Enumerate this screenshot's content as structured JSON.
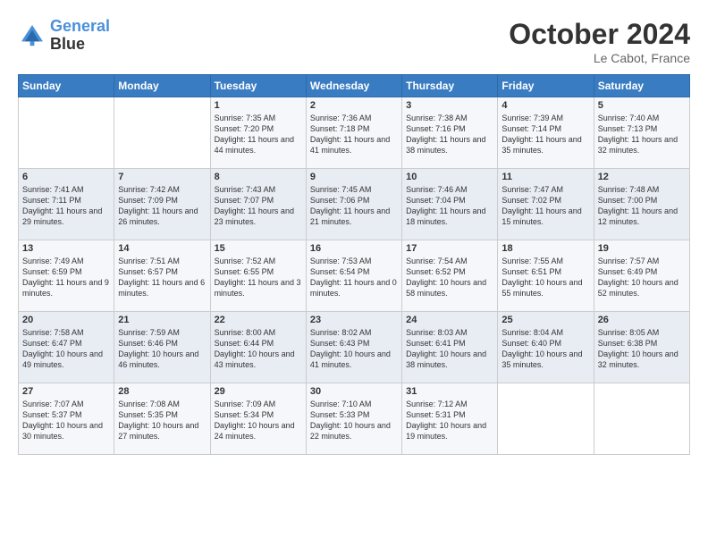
{
  "header": {
    "logo_line1": "General",
    "logo_line2": "Blue",
    "month": "October 2024",
    "location": "Le Cabot, France"
  },
  "weekdays": [
    "Sunday",
    "Monday",
    "Tuesday",
    "Wednesday",
    "Thursday",
    "Friday",
    "Saturday"
  ],
  "weeks": [
    [
      {
        "day": null
      },
      {
        "day": null
      },
      {
        "day": "1",
        "sunrise": "Sunrise: 7:35 AM",
        "sunset": "Sunset: 7:20 PM",
        "daylight": "Daylight: 11 hours and 44 minutes."
      },
      {
        "day": "2",
        "sunrise": "Sunrise: 7:36 AM",
        "sunset": "Sunset: 7:18 PM",
        "daylight": "Daylight: 11 hours and 41 minutes."
      },
      {
        "day": "3",
        "sunrise": "Sunrise: 7:38 AM",
        "sunset": "Sunset: 7:16 PM",
        "daylight": "Daylight: 11 hours and 38 minutes."
      },
      {
        "day": "4",
        "sunrise": "Sunrise: 7:39 AM",
        "sunset": "Sunset: 7:14 PM",
        "daylight": "Daylight: 11 hours and 35 minutes."
      },
      {
        "day": "5",
        "sunrise": "Sunrise: 7:40 AM",
        "sunset": "Sunset: 7:13 PM",
        "daylight": "Daylight: 11 hours and 32 minutes."
      }
    ],
    [
      {
        "day": "6",
        "sunrise": "Sunrise: 7:41 AM",
        "sunset": "Sunset: 7:11 PM",
        "daylight": "Daylight: 11 hours and 29 minutes."
      },
      {
        "day": "7",
        "sunrise": "Sunrise: 7:42 AM",
        "sunset": "Sunset: 7:09 PM",
        "daylight": "Daylight: 11 hours and 26 minutes."
      },
      {
        "day": "8",
        "sunrise": "Sunrise: 7:43 AM",
        "sunset": "Sunset: 7:07 PM",
        "daylight": "Daylight: 11 hours and 23 minutes."
      },
      {
        "day": "9",
        "sunrise": "Sunrise: 7:45 AM",
        "sunset": "Sunset: 7:06 PM",
        "daylight": "Daylight: 11 hours and 21 minutes."
      },
      {
        "day": "10",
        "sunrise": "Sunrise: 7:46 AM",
        "sunset": "Sunset: 7:04 PM",
        "daylight": "Daylight: 11 hours and 18 minutes."
      },
      {
        "day": "11",
        "sunrise": "Sunrise: 7:47 AM",
        "sunset": "Sunset: 7:02 PM",
        "daylight": "Daylight: 11 hours and 15 minutes."
      },
      {
        "day": "12",
        "sunrise": "Sunrise: 7:48 AM",
        "sunset": "Sunset: 7:00 PM",
        "daylight": "Daylight: 11 hours and 12 minutes."
      }
    ],
    [
      {
        "day": "13",
        "sunrise": "Sunrise: 7:49 AM",
        "sunset": "Sunset: 6:59 PM",
        "daylight": "Daylight: 11 hours and 9 minutes."
      },
      {
        "day": "14",
        "sunrise": "Sunrise: 7:51 AM",
        "sunset": "Sunset: 6:57 PM",
        "daylight": "Daylight: 11 hours and 6 minutes."
      },
      {
        "day": "15",
        "sunrise": "Sunrise: 7:52 AM",
        "sunset": "Sunset: 6:55 PM",
        "daylight": "Daylight: 11 hours and 3 minutes."
      },
      {
        "day": "16",
        "sunrise": "Sunrise: 7:53 AM",
        "sunset": "Sunset: 6:54 PM",
        "daylight": "Daylight: 11 hours and 0 minutes."
      },
      {
        "day": "17",
        "sunrise": "Sunrise: 7:54 AM",
        "sunset": "Sunset: 6:52 PM",
        "daylight": "Daylight: 10 hours and 58 minutes."
      },
      {
        "day": "18",
        "sunrise": "Sunrise: 7:55 AM",
        "sunset": "Sunset: 6:51 PM",
        "daylight": "Daylight: 10 hours and 55 minutes."
      },
      {
        "day": "19",
        "sunrise": "Sunrise: 7:57 AM",
        "sunset": "Sunset: 6:49 PM",
        "daylight": "Daylight: 10 hours and 52 minutes."
      }
    ],
    [
      {
        "day": "20",
        "sunrise": "Sunrise: 7:58 AM",
        "sunset": "Sunset: 6:47 PM",
        "daylight": "Daylight: 10 hours and 49 minutes."
      },
      {
        "day": "21",
        "sunrise": "Sunrise: 7:59 AM",
        "sunset": "Sunset: 6:46 PM",
        "daylight": "Daylight: 10 hours and 46 minutes."
      },
      {
        "day": "22",
        "sunrise": "Sunrise: 8:00 AM",
        "sunset": "Sunset: 6:44 PM",
        "daylight": "Daylight: 10 hours and 43 minutes."
      },
      {
        "day": "23",
        "sunrise": "Sunrise: 8:02 AM",
        "sunset": "Sunset: 6:43 PM",
        "daylight": "Daylight: 10 hours and 41 minutes."
      },
      {
        "day": "24",
        "sunrise": "Sunrise: 8:03 AM",
        "sunset": "Sunset: 6:41 PM",
        "daylight": "Daylight: 10 hours and 38 minutes."
      },
      {
        "day": "25",
        "sunrise": "Sunrise: 8:04 AM",
        "sunset": "Sunset: 6:40 PM",
        "daylight": "Daylight: 10 hours and 35 minutes."
      },
      {
        "day": "26",
        "sunrise": "Sunrise: 8:05 AM",
        "sunset": "Sunset: 6:38 PM",
        "daylight": "Daylight: 10 hours and 32 minutes."
      }
    ],
    [
      {
        "day": "27",
        "sunrise": "Sunrise: 7:07 AM",
        "sunset": "Sunset: 5:37 PM",
        "daylight": "Daylight: 10 hours and 30 minutes."
      },
      {
        "day": "28",
        "sunrise": "Sunrise: 7:08 AM",
        "sunset": "Sunset: 5:35 PM",
        "daylight": "Daylight: 10 hours and 27 minutes."
      },
      {
        "day": "29",
        "sunrise": "Sunrise: 7:09 AM",
        "sunset": "Sunset: 5:34 PM",
        "daylight": "Daylight: 10 hours and 24 minutes."
      },
      {
        "day": "30",
        "sunrise": "Sunrise: 7:10 AM",
        "sunset": "Sunset: 5:33 PM",
        "daylight": "Daylight: 10 hours and 22 minutes."
      },
      {
        "day": "31",
        "sunrise": "Sunrise: 7:12 AM",
        "sunset": "Sunset: 5:31 PM",
        "daylight": "Daylight: 10 hours and 19 minutes."
      },
      {
        "day": null
      },
      {
        "day": null
      }
    ]
  ]
}
